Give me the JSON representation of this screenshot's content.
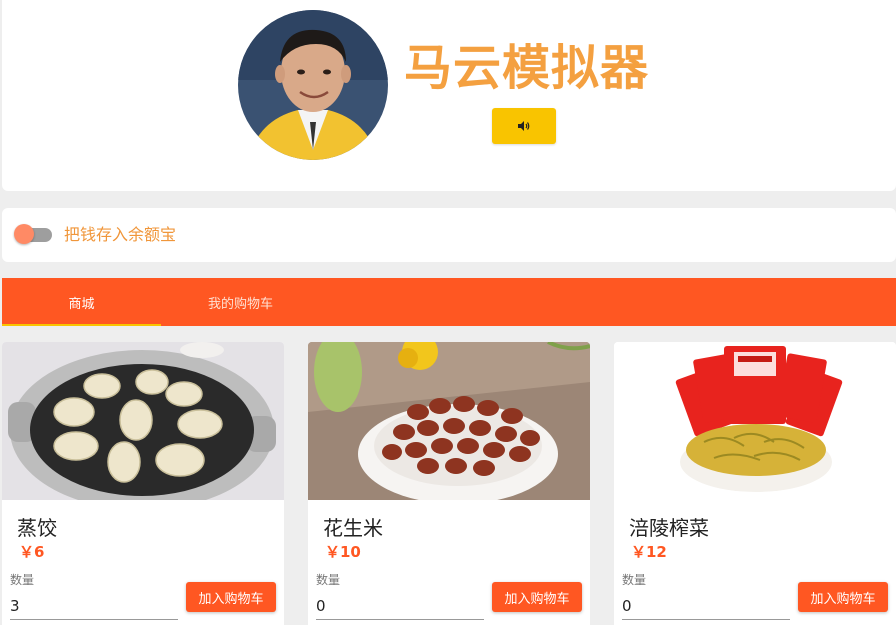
{
  "header": {
    "title": "马云模拟器",
    "sound_icon": "speaker-icon",
    "title_color": "#f4a040",
    "button_color": "#f9c400"
  },
  "toggle": {
    "label": "把钱存入余额宝",
    "on": false
  },
  "tabs": [
    {
      "label": "商城",
      "active": true
    },
    {
      "label": "我的购物车",
      "active": false
    }
  ],
  "products": [
    {
      "name": "蒸饺",
      "price": "￥6",
      "qty_label": "数量",
      "qty": "3",
      "add_label": "加入购物车"
    },
    {
      "name": "花生米",
      "price": "￥10",
      "qty_label": "数量",
      "qty": "0",
      "add_label": "加入购物车"
    },
    {
      "name": "涪陵榨菜",
      "price": "￥12",
      "qty_label": "数量",
      "qty": "0",
      "add_label": "加入购物车"
    }
  ],
  "brand": {
    "accent": "#ff5722",
    "indicator": "#f9c400"
  }
}
